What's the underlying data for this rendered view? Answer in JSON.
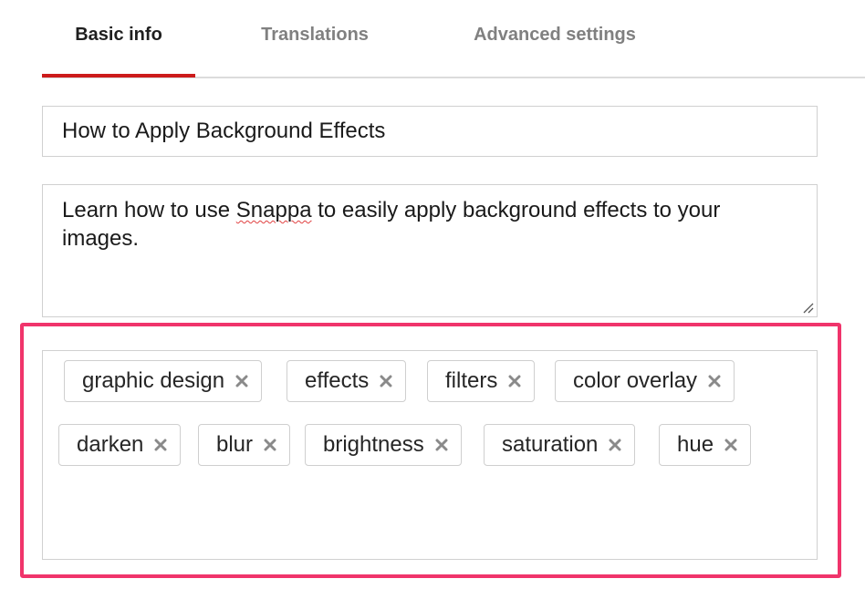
{
  "tabs": [
    {
      "label": "Basic info",
      "active": true
    },
    {
      "label": "Translations",
      "active": false
    },
    {
      "label": "Advanced settings",
      "active": false
    }
  ],
  "title_field": {
    "value": "How to Apply Background Effects"
  },
  "description": {
    "before": "Learn how to use ",
    "misspelled": "Snappa",
    "after": " to easily apply background effects to your images."
  },
  "tags": [
    "graphic design",
    "effects",
    "filters",
    "color overlay",
    "darken",
    "blur",
    "brightness",
    "saturation",
    "hue"
  ],
  "colors": {
    "active_tab_underline": "#cc1b1b",
    "highlight_border": "#f0346b",
    "field_border": "#d0d0d0",
    "tag_remove_icon": "#8a8a8a"
  },
  "icons": {
    "tag_remove": "close-icon",
    "textarea_resize": "resize-grip-icon"
  }
}
